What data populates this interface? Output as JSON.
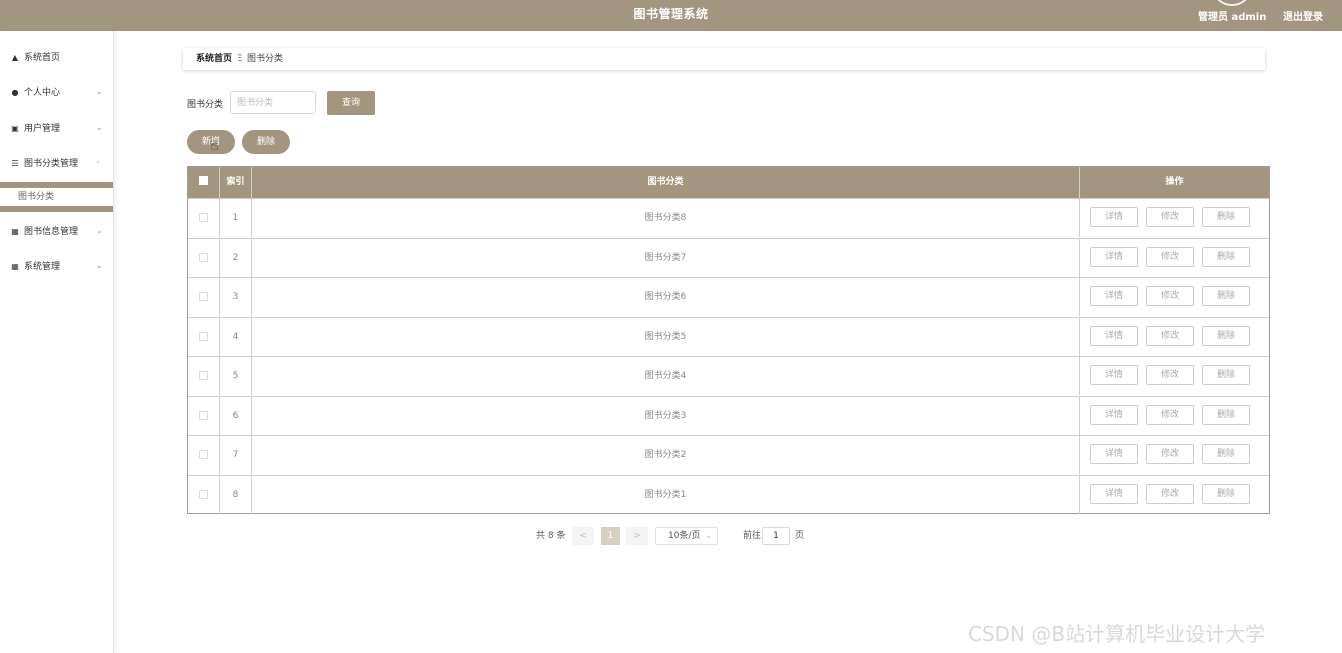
{
  "header": {
    "title": "图书管理系统",
    "user": "管理员 admin",
    "logout": "退出登录",
    "color": "#a39680"
  },
  "sidebar": {
    "items": [
      {
        "icon": "home-icon",
        "label": "系统首页"
      },
      {
        "icon": "user-icon",
        "label": "个人中心"
      },
      {
        "icon": "clipboard-icon",
        "label": "用户管理"
      },
      {
        "icon": "list-icon",
        "label": "图书分类管理"
      },
      {
        "icon": "grid-icon",
        "label": "图书信息管理"
      },
      {
        "icon": "grid-icon",
        "label": "系统管理"
      }
    ],
    "submenu": {
      "label": "图书分类"
    }
  },
  "breadcrumb": {
    "home": "系统首页",
    "separator": "Ξ",
    "current": "图书分类"
  },
  "search": {
    "label": "图书分类",
    "placeholder": "图书分类",
    "query_label": "查询"
  },
  "actions": {
    "add_label": "新增",
    "delete_label": "删除"
  },
  "table": {
    "columns": [
      "索引",
      "图书分类",
      "操作"
    ],
    "rows": [
      {
        "index": "1",
        "name": "图书分类8"
      },
      {
        "index": "2",
        "name": "图书分类7"
      },
      {
        "index": "3",
        "name": "图书分类6"
      },
      {
        "index": "4",
        "name": "图书分类5"
      },
      {
        "index": "5",
        "name": "图书分类4"
      },
      {
        "index": "6",
        "name": "图书分类3"
      },
      {
        "index": "7",
        "name": "图书分类2"
      },
      {
        "index": "8",
        "name": "图书分类1"
      }
    ],
    "row_actions": [
      "详情",
      "修改",
      "删除"
    ]
  },
  "pagination": {
    "total": "共 8 条",
    "prev": "<",
    "page": "1",
    "next": ">",
    "page_size": "10条/页",
    "goto": "前往",
    "goto_value": "1",
    "unit": "页"
  },
  "watermark": "CSDN @B站计算机毕业设计大学"
}
